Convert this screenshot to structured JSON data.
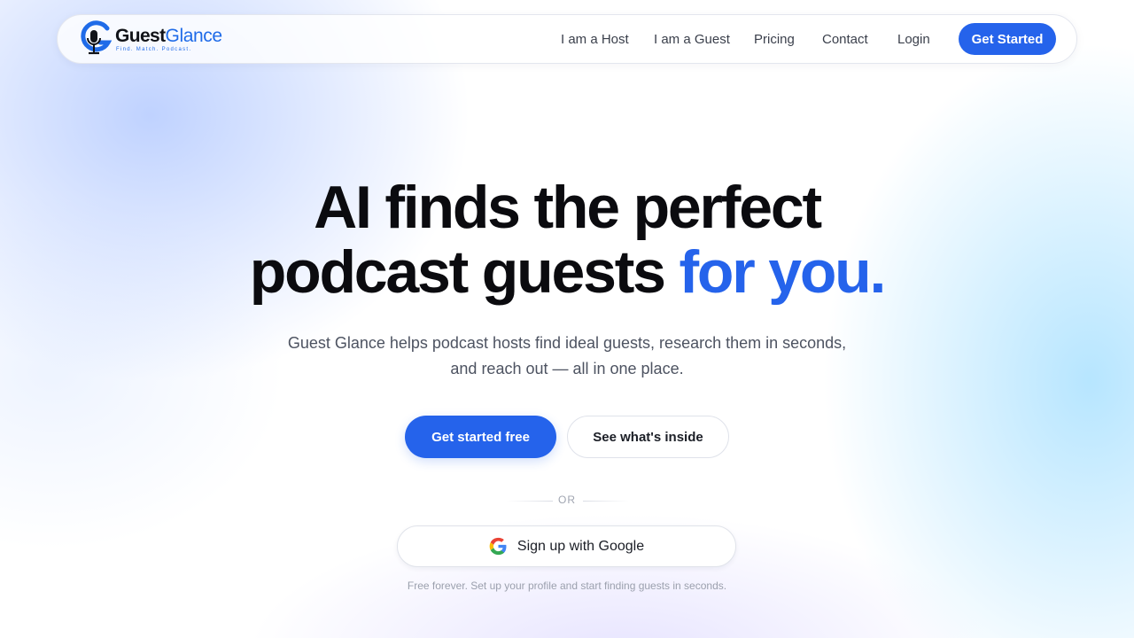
{
  "brand": {
    "name_part1": "Guest",
    "name_part2": "Glance",
    "tagline": "Find. Match. Podcast."
  },
  "nav": {
    "links": [
      "I am a Host",
      "I am a Guest",
      "Pricing",
      "Contact",
      "Login"
    ],
    "cta": "Get Started"
  },
  "hero": {
    "headline_line1": "AI finds the perfect",
    "headline_line2": "podcast guests",
    "headline_accent": "for you.",
    "subtext_line1": "Guest Glance helps podcast hosts find ideal guests, research them in seconds,",
    "subtext_line2": "and reach out — all in one place.",
    "primary_button": "Get started free",
    "secondary_button": "See what's inside",
    "divider": "OR",
    "google_button": "Sign up with Google",
    "fineprint": "Free forever. Set up your profile and start finding guests in seconds."
  },
  "colors": {
    "accent": "#2563eb",
    "text": "#0b0b0f",
    "muted": "#4d5361"
  },
  "icons": {
    "logo": "microphone-g-logo-icon",
    "google": "google-g-icon"
  }
}
